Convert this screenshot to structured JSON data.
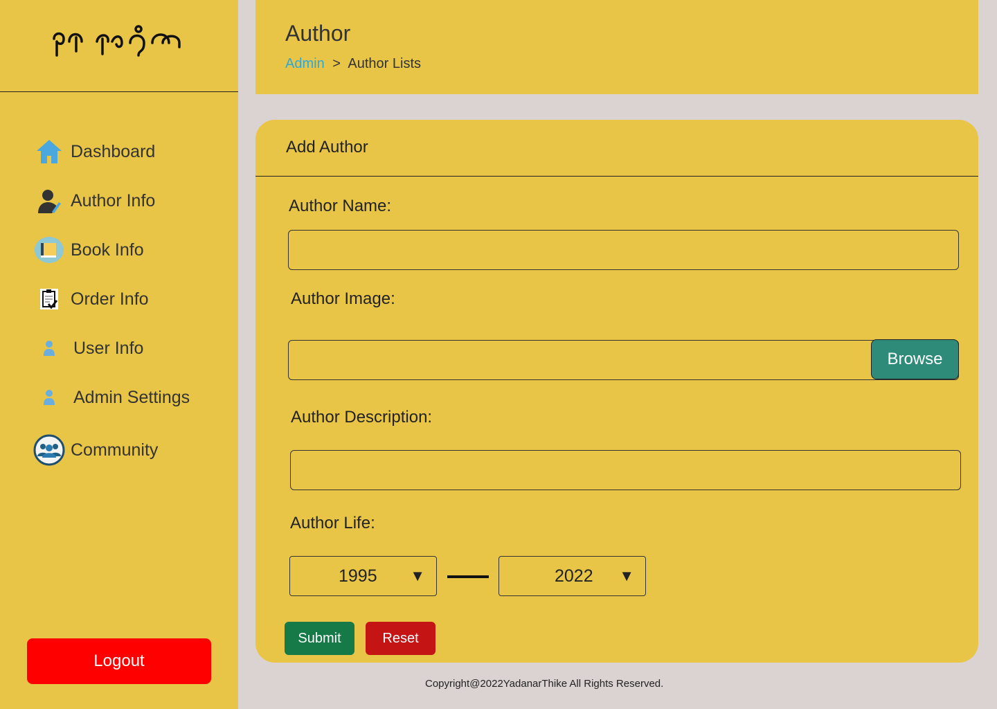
{
  "sidebar": {
    "logo": "ရတနာသိုက်",
    "items": [
      {
        "label": "Dashboard",
        "icon": "home-icon"
      },
      {
        "label": "Author Info",
        "icon": "author-icon"
      },
      {
        "label": "Book Info",
        "icon": "book-icon"
      },
      {
        "label": "Order Info",
        "icon": "clipboard-icon"
      },
      {
        "label": "User Info",
        "icon": "user-icon"
      },
      {
        "label": "Admin Settings",
        "icon": "user-icon"
      },
      {
        "label": "Community",
        "icon": "community-icon"
      }
    ],
    "logout": "Logout"
  },
  "header": {
    "title": "Author",
    "breadcrumb": {
      "root": "Admin",
      "sep": ">",
      "current": "Author Lists"
    }
  },
  "form": {
    "title": "Add Author",
    "name_label": "Author Name:",
    "name_value": "",
    "image_label": "Author Image:",
    "browse": "Browse",
    "desc_label": "Author Description:",
    "desc_value": "",
    "life_label": "Author Life:",
    "birth": "1995",
    "death": "2022",
    "submit": "Submit",
    "reset": "Reset"
  },
  "footer": "Copyright@2022YadanarThike All Rights Reserved."
}
